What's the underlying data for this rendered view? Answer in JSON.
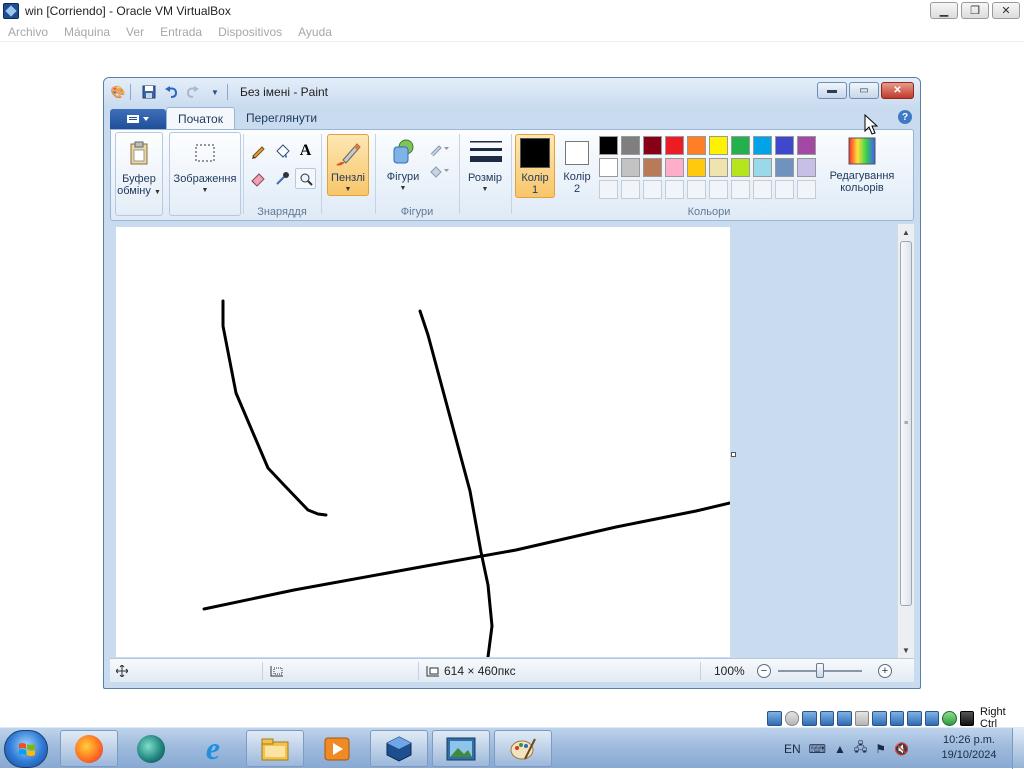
{
  "host": {
    "title": "win [Corriendo] - Oracle VM VirtualBox",
    "menu": [
      "Archivo",
      "Máquina",
      "Ver",
      "Entrada",
      "Dispositivos",
      "Ayuda"
    ],
    "status_text": "Right Ctrl",
    "status_icons": [
      "hdd-icon",
      "optical-drive-icon",
      "audio-icon",
      "network-icon",
      "usb-icon",
      "shared-folders-icon",
      "display-icon",
      "recording-icon",
      "capture-icon",
      "cpu-icon",
      "mouse-integration-icon",
      "keyboard-icon"
    ]
  },
  "paint": {
    "title": "Без імені - Paint",
    "file_menu_icon": "file-menu-icon",
    "tabs": [
      "Початок",
      "Переглянути"
    ],
    "active_tab": "Початок",
    "groups": {
      "clipboard": {
        "label_line1": "Буфер",
        "label_line2": "обміну"
      },
      "image": {
        "label": "Зображення"
      },
      "tools": {
        "label": "Знаряддя"
      },
      "brushes": {
        "label": "Пензлі"
      },
      "shapes": {
        "label": "Фігури",
        "button": "Фігури"
      },
      "size": {
        "label": "Розмір"
      },
      "color1": {
        "line1": "Колір",
        "line2": "1",
        "value": "#000000"
      },
      "color2": {
        "line1": "Колір",
        "line2": "2",
        "value": "#ffffff"
      },
      "colors": {
        "label": "Кольори"
      },
      "edit_colors": {
        "line1": "Редагування",
        "line2": "кольорів"
      }
    },
    "palette_row1": [
      "#000000",
      "#7f7f7f",
      "#880015",
      "#ed1c24",
      "#ff7f27",
      "#fff200",
      "#22b14c",
      "#00a2e8",
      "#3f48cc",
      "#a349a4"
    ],
    "palette_row2": [
      "#ffffff",
      "#c3c3c3",
      "#b97a57",
      "#ffaec9",
      "#ffc90e",
      "#efe4b0",
      "#b5e61d",
      "#99d9ea",
      "#7092be",
      "#c8bfe7"
    ],
    "status": {
      "dimensions": "614 × 460пкс",
      "zoom": "100%"
    }
  },
  "taskbar": {
    "apps": [
      "firefox-icon",
      "app-icon",
      "internet-explorer-icon",
      "file-explorer-icon",
      "media-player-icon",
      "virtualbox-icon",
      "photo-viewer-icon",
      "paint-icon"
    ],
    "language": "EN",
    "time": "10:26 p.m.",
    "date": "19/10/2024"
  }
}
